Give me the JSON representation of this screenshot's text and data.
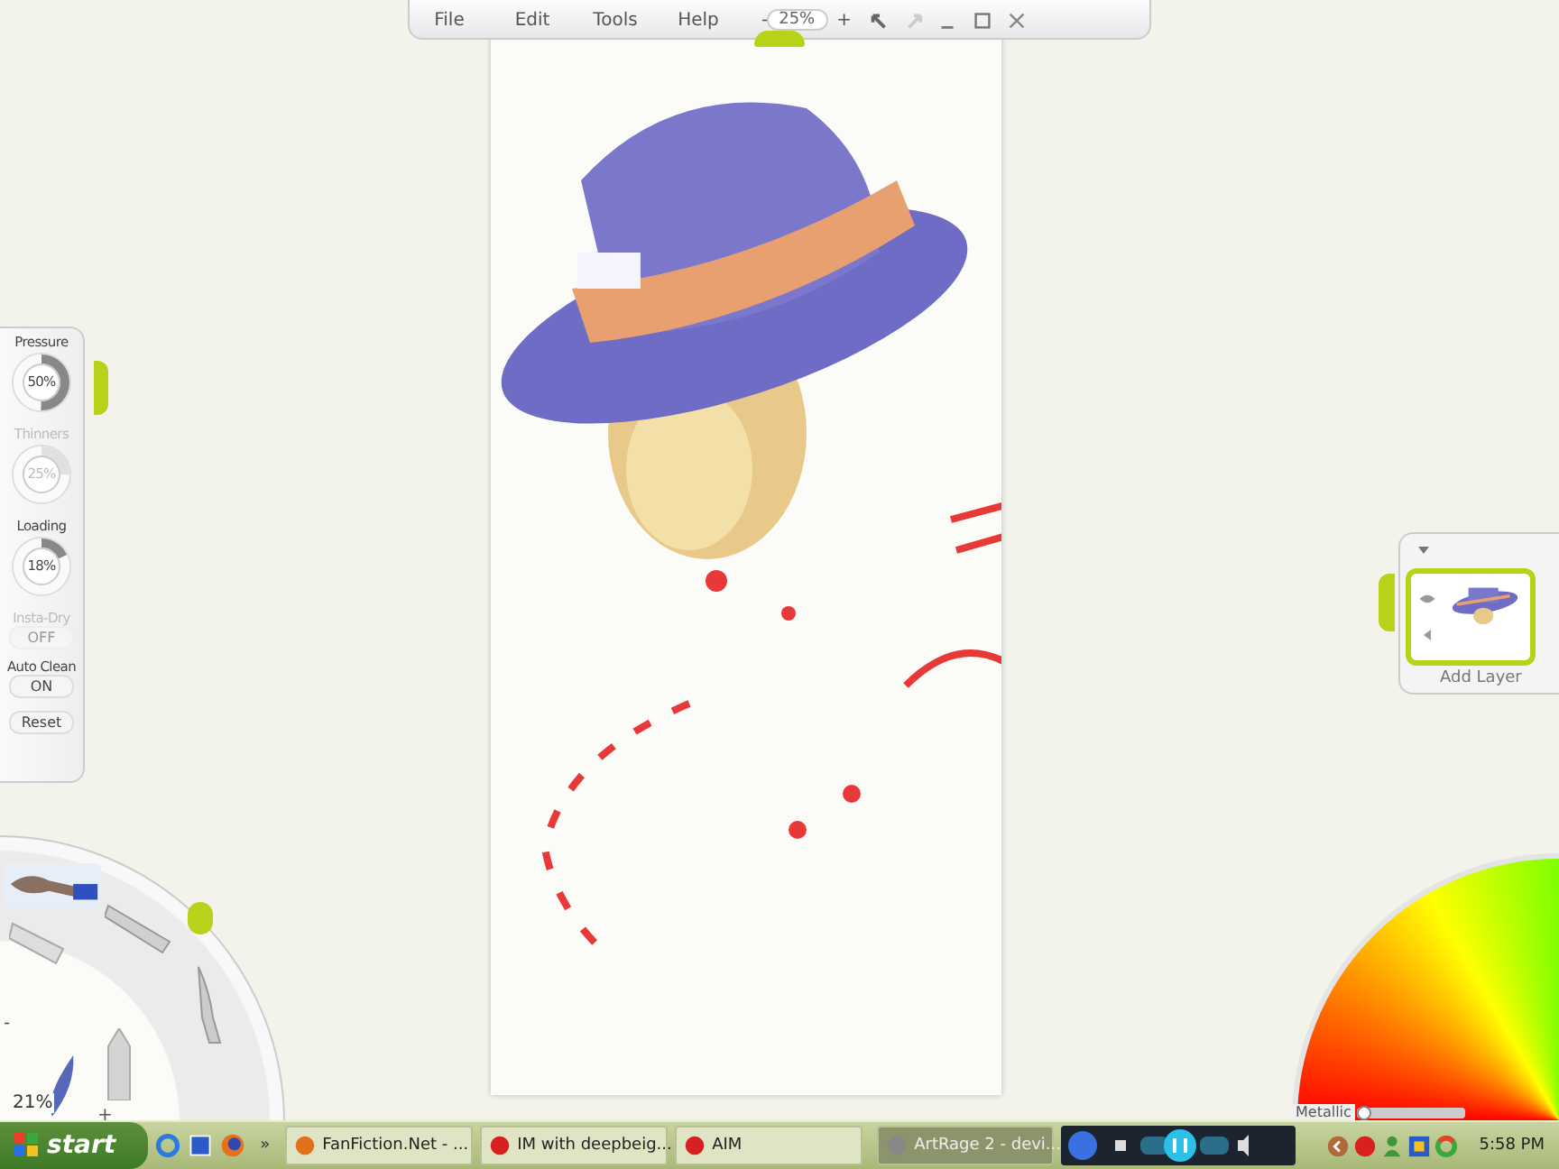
{
  "menu": {
    "items": [
      "File",
      "Edit",
      "Tools",
      "Help"
    ],
    "zoom_minus": "-",
    "zoom": "25%",
    "zoom_plus": "+"
  },
  "settings": {
    "controls": [
      {
        "kind": "dial",
        "label": "Pressure",
        "value": "50%",
        "level": 0.5,
        "disabled": false
      },
      {
        "kind": "dial",
        "label": "Thinners",
        "value": "25%",
        "level": 0.25,
        "disabled": true
      },
      {
        "kind": "dial",
        "label": "Loading",
        "value": "18%",
        "level": 0.18,
        "disabled": false
      },
      {
        "kind": "toggle",
        "label": "Insta-Dry",
        "value": "OFF",
        "disabled": true
      },
      {
        "kind": "toggle",
        "label": "Auto Clean",
        "value": "ON",
        "disabled": false
      }
    ],
    "reset": "Reset"
  },
  "tools": {
    "minus": "-",
    "size": "21%",
    "plus": "+"
  },
  "layers": {
    "add_label": "Add Layer"
  },
  "color_picker": {
    "metallic": {
      "label": "Metallic",
      "level": 0
    }
  },
  "taskbar": {
    "start": "start",
    "overflow": "»",
    "tasks": [
      {
        "label": "FanFiction.Net - ...",
        "selected": false
      },
      {
        "label": "IM with deepbeig...",
        "selected": false
      },
      {
        "label": "AIM",
        "selected": false
      },
      {
        "label": "ArtRage 2 - devi...",
        "selected": true
      }
    ],
    "clock": "5:58 PM"
  }
}
